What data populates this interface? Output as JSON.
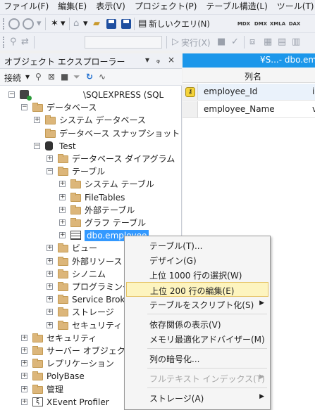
{
  "menubar": [
    "ファイル(F)",
    "編集(E)",
    "表示(V)",
    "プロジェクト(P)",
    "テーブル構造(L)",
    "ツール(T)",
    "ウィ"
  ],
  "toolbar": {
    "new_query": "新しいクエリ(N)",
    "execute": "実行(X)",
    "mini": [
      "MDX",
      "DMX",
      "XMLA",
      "DAX"
    ]
  },
  "object_explorer": {
    "title": "オブジェクト エクスプローラー",
    "pin": "ᵩ",
    "close": "×",
    "connect": "接続",
    "tree": [
      {
        "label": "\\SQLEXPRESS (SQL",
        "indent": 0,
        "expander": "-",
        "icon": "server"
      },
      {
        "label": "データベース",
        "indent": 1,
        "expander": "-",
        "icon": "folder"
      },
      {
        "label": "システム データベース",
        "indent": 2,
        "expander": "+",
        "icon": "folder"
      },
      {
        "label": "データベース スナップショット",
        "indent": 2,
        "expander": "",
        "icon": "folder"
      },
      {
        "label": "Test",
        "indent": 2,
        "expander": "-",
        "icon": "db"
      },
      {
        "label": "データベース ダイアグラム",
        "indent": 3,
        "expander": "+",
        "icon": "folder"
      },
      {
        "label": "テーブル",
        "indent": 3,
        "expander": "-",
        "icon": "folder"
      },
      {
        "label": "システム テーブル",
        "indent": 4,
        "expander": "+",
        "icon": "folder"
      },
      {
        "label": "FileTables",
        "indent": 4,
        "expander": "+",
        "icon": "folder"
      },
      {
        "label": "外部テーブル",
        "indent": 4,
        "expander": "+",
        "icon": "folder"
      },
      {
        "label": "グラフ テーブル",
        "indent": 4,
        "expander": "+",
        "icon": "folder"
      },
      {
        "label": "dbo.employee",
        "indent": 4,
        "expander": "+",
        "icon": "table",
        "selected": true
      },
      {
        "label": "ビュー",
        "indent": 3,
        "expander": "+",
        "icon": "folder"
      },
      {
        "label": "外部リソース",
        "indent": 3,
        "expander": "+",
        "icon": "folder"
      },
      {
        "label": "シノニム",
        "indent": 3,
        "expander": "+",
        "icon": "folder"
      },
      {
        "label": "プログラミング",
        "indent": 3,
        "expander": "+",
        "icon": "folder"
      },
      {
        "label": "Service Broke",
        "indent": 3,
        "expander": "+",
        "icon": "folder"
      },
      {
        "label": "ストレージ",
        "indent": 3,
        "expander": "+",
        "icon": "folder"
      },
      {
        "label": "セキュリティ",
        "indent": 3,
        "expander": "+",
        "icon": "folder"
      },
      {
        "label": "セキュリティ",
        "indent": 1,
        "expander": "+",
        "icon": "folder"
      },
      {
        "label": "サーバー オブジェクト",
        "indent": 1,
        "expander": "+",
        "icon": "folder"
      },
      {
        "label": "レプリケーション",
        "indent": 1,
        "expander": "+",
        "icon": "folder"
      },
      {
        "label": "PolyBase",
        "indent": 1,
        "expander": "+",
        "icon": "folder"
      },
      {
        "label": "管理",
        "indent": 1,
        "expander": "+",
        "icon": "folder"
      },
      {
        "label": "XEvent Profiler",
        "indent": 1,
        "expander": "+",
        "icon": "xevent"
      }
    ]
  },
  "document": {
    "tab_title": "¥S...- dbo.emplo",
    "column_header": "列名",
    "rows": [
      {
        "name": "employee_Id",
        "type": "i",
        "primary_key": true
      },
      {
        "name": "employee_Name",
        "type": "v",
        "primary_key": false
      }
    ]
  },
  "context_menu": {
    "items": [
      {
        "label": "テーブル(T)...",
        "submenu": false,
        "highlighted": false,
        "disabled": false
      },
      {
        "label": "デザイン(G)",
        "submenu": false,
        "highlighted": false,
        "disabled": false
      },
      {
        "label": "上位 1000 行の選択(W)",
        "submenu": false,
        "highlighted": false,
        "disabled": false
      },
      {
        "label": "上位 200 行の編集(E)",
        "submenu": false,
        "highlighted": true,
        "disabled": false
      },
      {
        "label": "テーブルをスクリプト化(S)",
        "submenu": true,
        "highlighted": false,
        "disabled": false
      },
      {
        "separator": true
      },
      {
        "label": "依存関係の表示(V)",
        "submenu": false,
        "highlighted": false,
        "disabled": false
      },
      {
        "label": "メモリ最適化アドバイザー(M)",
        "submenu": false,
        "highlighted": false,
        "disabled": false
      },
      {
        "separator": true
      },
      {
        "label": "列の暗号化...",
        "submenu": false,
        "highlighted": false,
        "disabled": false
      },
      {
        "separator": true
      },
      {
        "label": "フルテキスト インデックス(T)",
        "submenu": true,
        "highlighted": false,
        "disabled": true
      },
      {
        "separator": true
      },
      {
        "label": "ストレージ(A)",
        "submenu": true,
        "highlighted": false,
        "disabled": false
      }
    ]
  },
  "colors": {
    "accent": "#1c97ea",
    "selection": "#3399ff",
    "menu_highlight": "#fdf4bf"
  }
}
